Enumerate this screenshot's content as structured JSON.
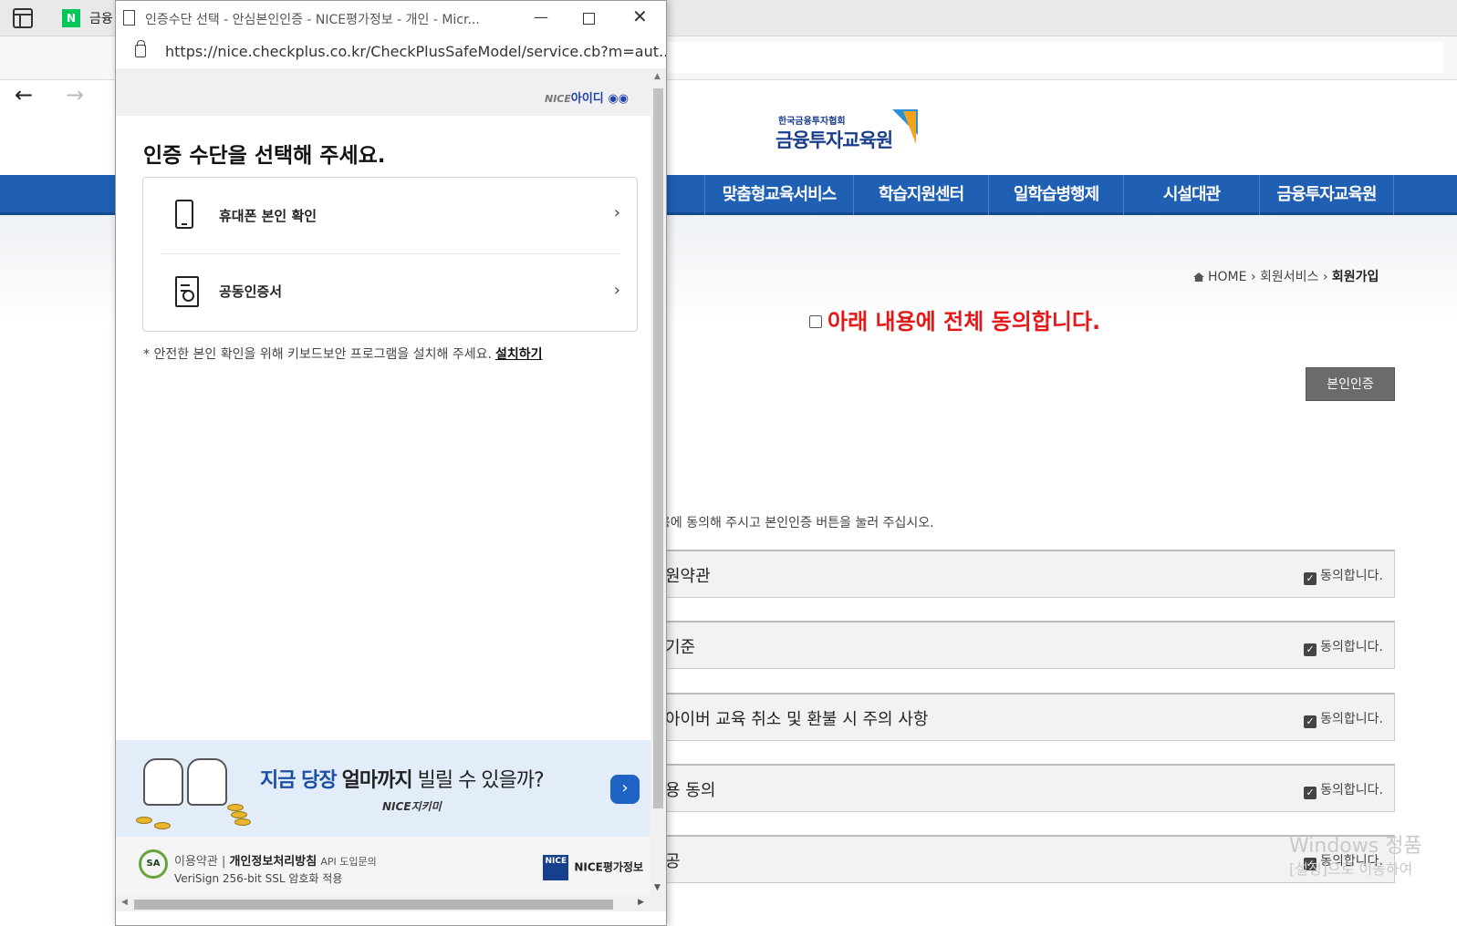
{
  "background_browser": {
    "tab_label": "금융",
    "site": {
      "logo_small": "한국금융투자협회",
      "logo_big": "금융투자교육원",
      "nav_items": [
        "맞춤형교육서비스",
        "학습지원센터",
        "일학습병행제",
        "시설대관",
        "금융투자교육원"
      ],
      "breadcrumb": {
        "home": "HOME",
        "sep1": "›",
        "level1": "회원서비스",
        "sep2": "›",
        "level2": "회원가입"
      },
      "agree_all_label": "아래 내용에 전체 동의합니다.",
      "cert_button": "본인인증",
      "guide_text": "용에 동의해 주시고 본인인증 버튼을 눌러 주십시오.",
      "sections": [
        {
          "title": "원약관",
          "agree": "동의합니다."
        },
        {
          "title": "기준",
          "agree": "동의합니다."
        },
        {
          "title": "아이버 교육 취소 및 환불 시 주의 사항",
          "agree": "동의합니다."
        },
        {
          "title": "용 동의",
          "agree": "동의합니다."
        },
        {
          "title": "공",
          "agree": "동의합니다."
        }
      ]
    },
    "watermark_line1": "Windows 정품",
    "watermark_line2": "[설정]으로 이동하여"
  },
  "popup": {
    "window_title": "인증수단 선택 - 안심본인인증 - NICE평가정보 - 개인 - Micr...",
    "url": "https://nice.checkplus.co.kr/CheckPlusSafeModel/service.cb?m=aut...",
    "header_logo_prefix": "NICE",
    "header_logo": "아이디",
    "heading": "인증 수단을 선택해 주세요.",
    "methods": [
      {
        "label": "휴대폰 본인 확인"
      },
      {
        "label": "공동인증서"
      }
    ],
    "notice": "* 안전한 본인 확인을 위해 키보드보안 프로그램을 설치해 주세요.",
    "install_link": "설치하기",
    "banner": {
      "text_a": "지금 당장",
      "text_b": "얼마까지",
      "text_c": "빌릴 수 있을까?",
      "sub": "NICE지키미"
    },
    "footer": {
      "seal": "SA",
      "terms": "이용약관",
      "privacy": "개인정보처리방침",
      "api": "API 도입문의",
      "ssl": "VeriSign 256-bit SSL 암호화 적용",
      "brand": "NICE평가정보",
      "brand_box": "NICE"
    }
  },
  "colors": {
    "accent_blue": "#1f5fb4",
    "agree_red": "#e51818",
    "button_gray": "#6b6b6b"
  }
}
